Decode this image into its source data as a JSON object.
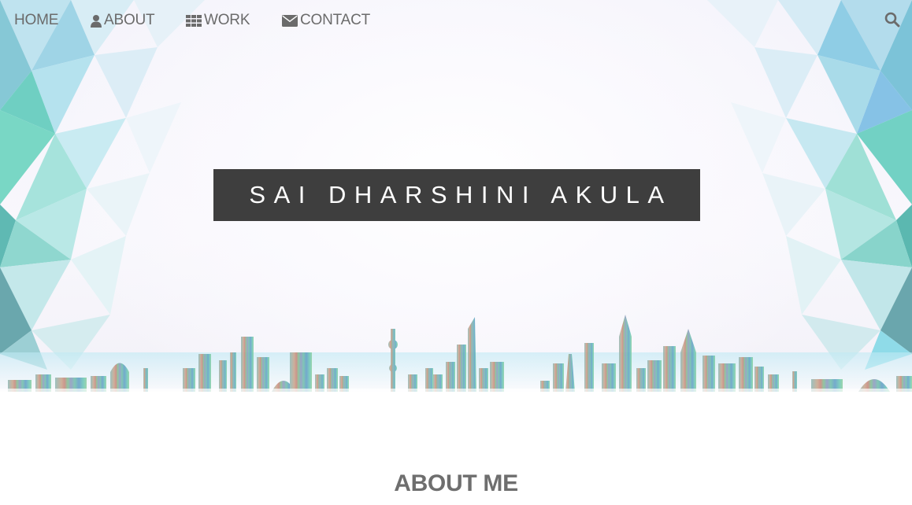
{
  "nav": {
    "items": [
      {
        "label": "HOME",
        "icon": ""
      },
      {
        "label": "ABOUT",
        "icon": "user-icon"
      },
      {
        "label": "WORK",
        "icon": "grid-icon"
      },
      {
        "label": "CONTACT",
        "icon": "envelope-icon"
      }
    ],
    "search_icon": "search-icon"
  },
  "hero": {
    "name": "SAI DHARSHINI AKULA"
  },
  "about": {
    "heading": "ABOUT ME"
  },
  "colors": {
    "nav_text": "#6b6b6b",
    "title_bg": "#3e3e3e",
    "title_text": "#ffffff",
    "heading_text": "#6e6e6e",
    "poly_teal": "#7fd6cf",
    "poly_blue": "#8ccbe8"
  }
}
